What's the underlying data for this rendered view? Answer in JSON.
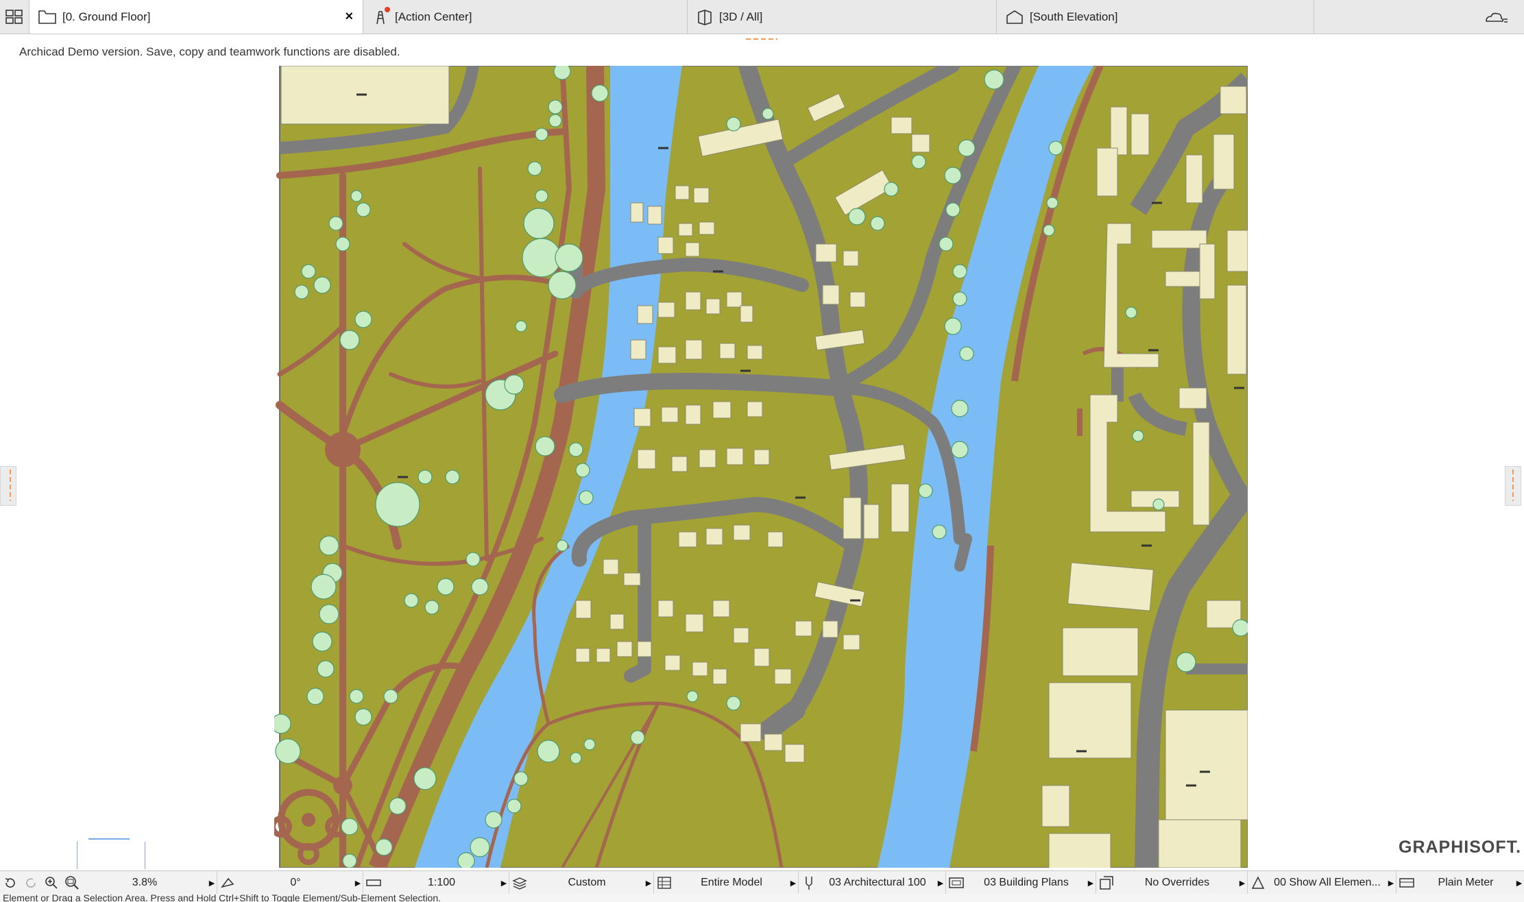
{
  "tabs": [
    {
      "label": "[0. Ground Floor]",
      "icon": "floor-plan-icon",
      "active": true
    },
    {
      "label": "[Action Center]",
      "icon": "action-center-icon",
      "active": false
    },
    {
      "label": "[3D / All]",
      "icon": "3d-view-icon",
      "active": false
    },
    {
      "label": "[South Elevation]",
      "icon": "elevation-icon",
      "active": false
    }
  ],
  "canvas": {
    "notice": "Archicad Demo version. Save, copy and teamwork functions are disabled.",
    "brand": "GRAPHISOFT."
  },
  "statusbar": {
    "zoom": "3.8%",
    "angle": "0°",
    "scale": "1:100",
    "layers": "Custom",
    "model_view": "Entire Model",
    "pen_set": "03 Architectural 100",
    "view_set": "03 Building Plans",
    "overrides": "No Overrides",
    "renovation": "00 Show All Elemen...",
    "dimensions": "Plain Meter"
  },
  "hint": "Element or Drag a Selection Area. Press and Hold Ctrl+Shift to Toggle Element/Sub-Element Selection.",
  "colors": {
    "grass": "#a2a235",
    "river": "#7bbcf7",
    "road": "#7d7d7d",
    "path": "#a5664f",
    "building": "#eeebc5",
    "tree": "#c8ecc4"
  }
}
